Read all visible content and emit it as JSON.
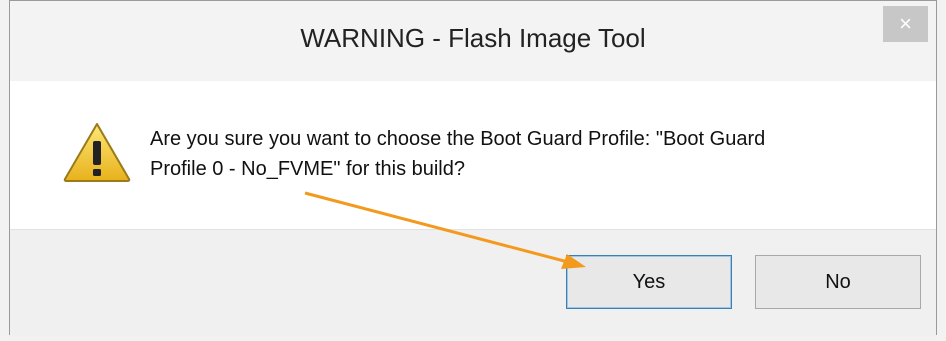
{
  "dialog": {
    "title": "WARNING - Flash Image Tool",
    "close_glyph": "×",
    "message_line1": "Are you sure you want to choose the Boot Guard Profile: \"Boot Guard",
    "message_line2": "Profile 0 - No_FVME\" for this build?",
    "yes_label": "Yes",
    "no_label": "No",
    "icon": "warning-icon"
  },
  "colors": {
    "annotation_arrow": "#f39a1e",
    "warning_yellow": "#f7d13a"
  }
}
